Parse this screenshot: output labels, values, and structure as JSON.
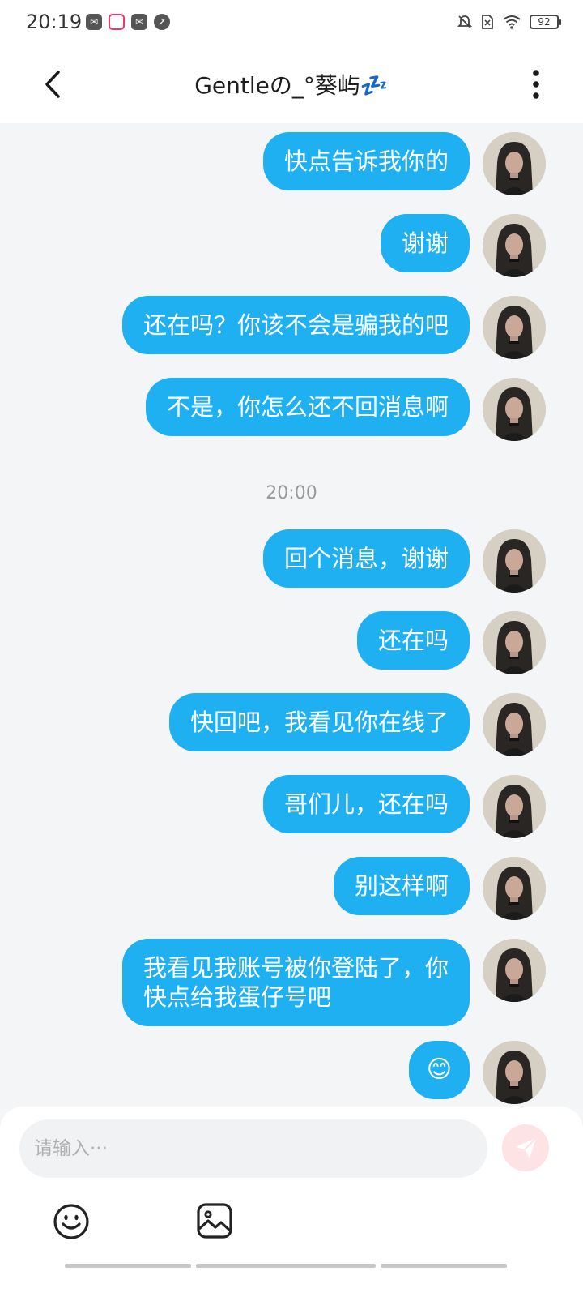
{
  "status_bar": {
    "time": "20:19",
    "battery": "92",
    "left_icons": [
      "app-notification-icon",
      "video-app-icon",
      "mail-icon",
      "compass-icon"
    ],
    "right_icons": [
      "bell-muted-icon",
      "no-sim-icon",
      "wifi-icon",
      "battery-icon"
    ]
  },
  "header": {
    "title": "Gentleの_°葵屿💤",
    "back_icon": "chevron-left-icon",
    "more_icon": "more-vertical-icon"
  },
  "messages": [
    {
      "text": "快点告诉我你的"
    },
    {
      "text": "谢谢"
    },
    {
      "text": "还在吗？你该不会是骗我的吧"
    },
    {
      "text": "不是，你怎么还不回消息啊"
    },
    {
      "text": "回个消息，谢谢"
    },
    {
      "text": "还在吗"
    },
    {
      "text": "快回吧，我看见你在线了"
    },
    {
      "text": "哥们儿，还在吗"
    },
    {
      "text": "别这样啊"
    },
    {
      "text": "我看见我账号被你登陆了，你\n快点给我蛋仔号吧"
    },
    {
      "text": "😊"
    }
  ],
  "time_divider": "20:00",
  "input": {
    "placeholder": "请输入···",
    "send_icon": "send-icon",
    "emoji_icon": "emoji-icon",
    "image_icon": "image-icon"
  },
  "colors": {
    "bubble": "#1fb0f2",
    "background": "#f3f5f7",
    "send_button": "#fde3e3"
  }
}
